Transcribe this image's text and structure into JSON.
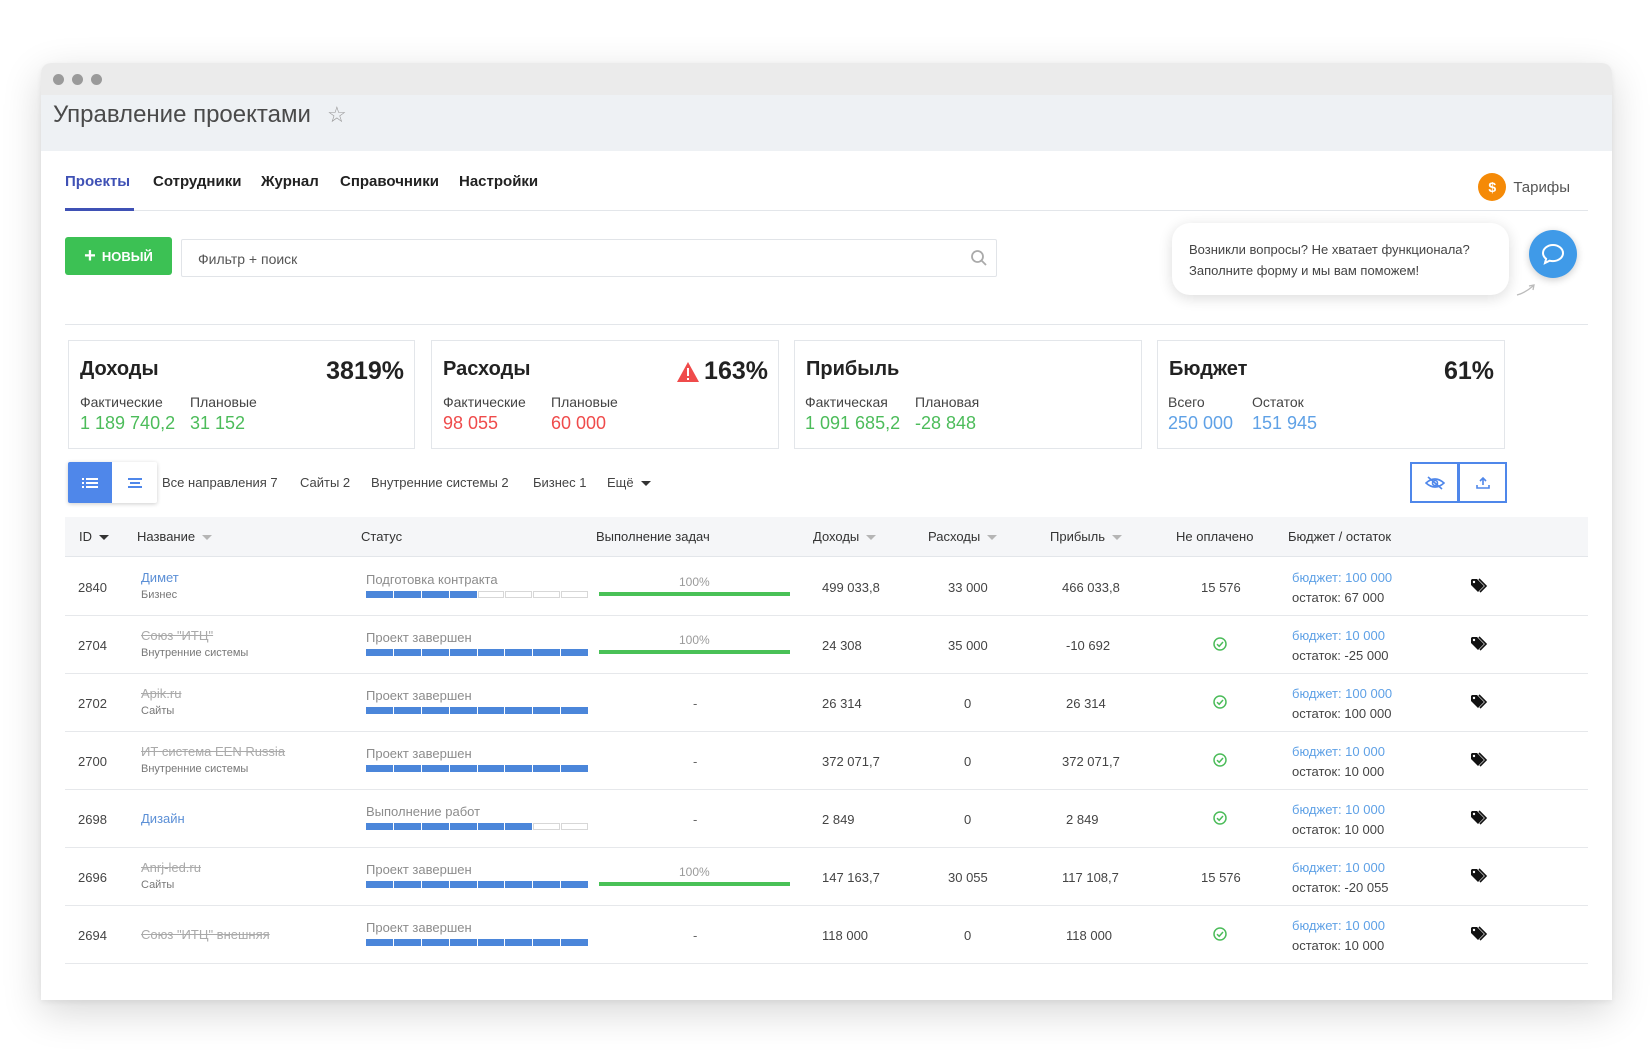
{
  "app": {
    "title": "Управление проектами"
  },
  "nav": {
    "tabs": [
      "Проекты",
      "Сотрудники",
      "Журнал",
      "Справочники",
      "Настройки"
    ],
    "tarify": "Тарифы",
    "coin": "$"
  },
  "toolbar": {
    "new_label": "НОВЫЙ",
    "new_plus": "+",
    "search_placeholder": "Фильтр + поиск"
  },
  "help": {
    "line1": "Возникли вопросы? Не хватает функционала?",
    "line2": "Заполните форму и мы вам поможем!"
  },
  "cards": [
    {
      "title": "Доходы",
      "pct": "3819%",
      "warn": false,
      "lbl1": "Фактические",
      "val1": "1 189 740,2",
      "lbl2": "Плановые",
      "val2": "31 152",
      "c1": "#4cbc5a",
      "c2": "#4cbc5a"
    },
    {
      "title": "Расходы",
      "pct": "163%",
      "warn": true,
      "lbl1": "Фактические",
      "val1": "98 055",
      "lbl2": "Плановые",
      "val2": "60 000",
      "c1": "#ef4b4b",
      "c2": "#ef4b4b"
    },
    {
      "title": "Прибыль",
      "pct": "",
      "warn": false,
      "lbl1": "Фактическая",
      "val1": "1 091 685,2",
      "lbl2": "Плановая",
      "val2": "-28 848",
      "c1": "#4cbc5a",
      "c2": "#4cbc5a"
    },
    {
      "title": "Бюджет",
      "pct": "61%",
      "warn": false,
      "lbl1": "Всего",
      "val1": "250 000",
      "lbl2": "Остаток",
      "val2": "151 945",
      "c1": "#5fa1e6",
      "c2": "#5fa1e6"
    }
  ],
  "filters": [
    "Все направления 7",
    "Сайты 2",
    "Внутренние системы 2",
    "Бизнес 1",
    "Ещё"
  ],
  "table": {
    "headers": [
      "ID",
      "Название",
      "Статус",
      "Выполнение задач",
      "Доходы",
      "Расходы",
      "Прибыль",
      "Не оплачено",
      "Бюджет / остаток"
    ],
    "rows": [
      {
        "id": "2840",
        "name": "Димет",
        "strike": false,
        "sub": "Бизнес",
        "status": "Подготовка контракта",
        "filled": 4,
        "segments": 8,
        "progress": "100%",
        "income": "499 033,8",
        "expense": "33 000",
        "profit": "466 033,8",
        "profit_red": false,
        "unpaid": "15 576",
        "budget": "бюджет: 100 000",
        "rest": "остаток: 67 000",
        "rest_red": false
      },
      {
        "id": "2704",
        "name": "Союз \"ИТЦ\"",
        "strike": true,
        "sub": "Внутренние системы",
        "status": "Проект завершен",
        "filled": 8,
        "segments": 8,
        "progress": "100%",
        "income": "24 308",
        "expense": "35 000",
        "profit": "-10 692",
        "profit_red": true,
        "unpaid": "",
        "budget": "бюджет: 10 000",
        "rest": "остаток: -25 000",
        "rest_red": true
      },
      {
        "id": "2702",
        "name": "Apik.ru",
        "strike": true,
        "sub": "Сайты",
        "status": "Проект завершен",
        "filled": 8,
        "segments": 8,
        "progress": "-",
        "income": "26 314",
        "expense": "0",
        "profit": "26 314",
        "profit_red": false,
        "unpaid": "",
        "budget": "бюджет: 100 000",
        "rest": "остаток: 100 000",
        "rest_red": false
      },
      {
        "id": "2700",
        "name": "ИТ система EEN Russia",
        "strike": true,
        "sub": "Внутренние системы",
        "status": "Проект завершен",
        "filled": 8,
        "segments": 8,
        "progress": "-",
        "income": "372 071,7",
        "expense": "0",
        "profit": "372 071,7",
        "profit_red": false,
        "unpaid": "",
        "budget": "бюджет: 10 000",
        "rest": "остаток: 10 000",
        "rest_red": false
      },
      {
        "id": "2698",
        "name": "Дизайн",
        "strike": false,
        "sub": "",
        "status": "Выполнение работ",
        "filled": 6,
        "segments": 8,
        "progress": "-",
        "income": "2 849",
        "expense": "0",
        "profit": "2 849",
        "profit_red": false,
        "unpaid": "",
        "budget": "бюджет: 10 000",
        "rest": "остаток: 10 000",
        "rest_red": false
      },
      {
        "id": "2696",
        "name": "Anrj-led.ru",
        "strike": true,
        "sub": "Сайты",
        "status": "Проект завершен",
        "filled": 8,
        "segments": 8,
        "progress": "100%",
        "income": "147 163,7",
        "expense": "30 055",
        "profit": "117 108,7",
        "profit_red": false,
        "unpaid": "15 576",
        "budget": "бюджет: 10 000",
        "rest": "остаток: -20 055",
        "rest_red": true
      },
      {
        "id": "2694",
        "name": "Союз \"ИТЦ\" внешняя",
        "strike": true,
        "sub": "",
        "status": "Проект завершен",
        "filled": 8,
        "segments": 8,
        "progress": "-",
        "income": "118 000",
        "expense": "0",
        "profit": "118 000",
        "profit_red": false,
        "unpaid": "",
        "budget": "бюджет: 10 000",
        "rest": "остаток: 10 000",
        "rest_red": false
      }
    ]
  }
}
